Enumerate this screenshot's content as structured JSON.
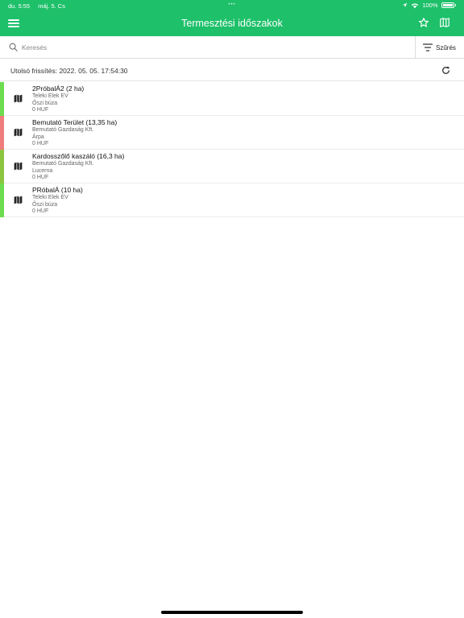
{
  "status_bar": {
    "time": "du. 5:55",
    "date": "máj. 5. Cs",
    "dots": "•••",
    "battery": "100%"
  },
  "header": {
    "title": "Termesztési időszakok",
    "menu_icon": "menu-icon",
    "star_icon": "star-icon",
    "map_icon": "map-icon"
  },
  "search": {
    "placeholder": "Keresés",
    "value": ""
  },
  "filter": {
    "label": "Szűrés",
    "icon": "filter-icon"
  },
  "refresh": {
    "text": "Utolsó frissítés: 2022. 05. 05. 17:54:30",
    "icon": "refresh-icon"
  },
  "items": [
    {
      "title": "2PróbalÁ2 (2 ha)",
      "owner": "Teleki Elek EV",
      "crop": "Őszi búza",
      "amount": "0 HUF",
      "color": "#6ddc4e"
    },
    {
      "title": "Bemutató Terület (13,35 ha)",
      "owner": "Bemutató Gazdaság Kft.",
      "crop": "Árpa",
      "amount": "0 HUF",
      "color": "#f07c7c"
    },
    {
      "title": "Kardosszőlő kaszáló (16,3 ha)",
      "owner": "Bemutató Gazdaság Kft.",
      "crop": "Lucerna",
      "amount": "0 HUF",
      "color": "#8cc63f"
    },
    {
      "title": "PRóbalÁ (10 ha)",
      "owner": "Teleki Elek EV",
      "crop": "Őszi búza",
      "amount": "0 HUF",
      "color": "#6ddc4e"
    }
  ]
}
